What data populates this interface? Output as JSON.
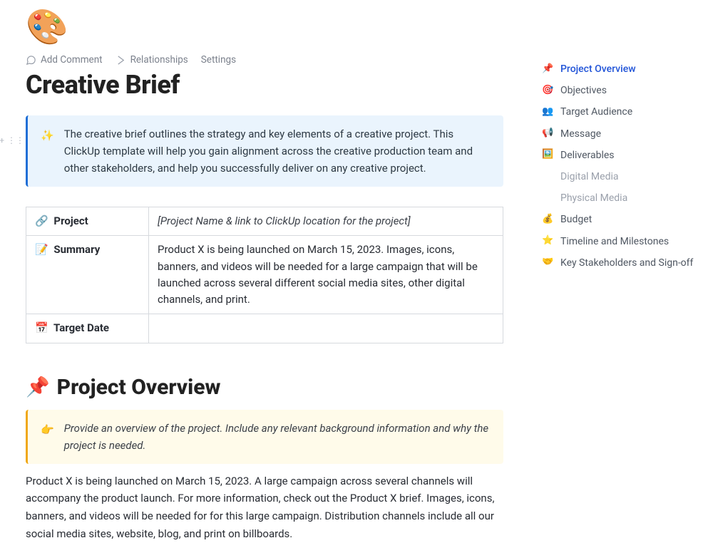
{
  "toolbar": {
    "add_comment": "Add Comment",
    "relationships": "Relationships",
    "settings": "Settings"
  },
  "page_title": "Creative Brief",
  "callout_intro": {
    "emoji": "✨",
    "text": "The creative brief outlines the strategy and key elements of a creative project. This ClickUp template will help you gain alignment across the creative production team and other stakeholders, and help you successfully deliver on any creative project."
  },
  "info_table": {
    "project": {
      "emoji": "🔗",
      "label": "Project",
      "value": "[Project Name & link to ClickUp location for the project]"
    },
    "summary": {
      "emoji": "📝",
      "label": "Summary",
      "value": "Product X is being launched on March 15, 2023. Images, icons, banners, and videos will be needed for a large campaign that will be launched across several different social media sites, other digital channels, and print."
    },
    "target_date": {
      "emoji": "📅",
      "label": "Target Date",
      "value": ""
    }
  },
  "section_overview": {
    "emoji": "📌",
    "title": "Project Overview",
    "hint_emoji": "👉",
    "hint": "Provide an overview of the project. Include any relevant background information and why the project is needed.",
    "body": "Product X is being launched on March 15, 2023. A large campaign across several channels will accompany the product launch. For more information, check out the Product X brief. Images, icons, banners, and videos will be needed for for this large campaign. Distribution channels include all our social media sites, website, blog, and print on billboards."
  },
  "toc": {
    "items": [
      {
        "emoji": "📌",
        "label": "Project Overview",
        "active": true
      },
      {
        "emoji": "🎯",
        "label": "Objectives"
      },
      {
        "emoji": "👥",
        "label": "Target Audience"
      },
      {
        "emoji": "📢",
        "label": "Message"
      },
      {
        "emoji": "🖼️",
        "label": "Deliverables"
      }
    ],
    "subs": [
      {
        "label": "Digital Media"
      },
      {
        "label": "Physical Media"
      }
    ],
    "items2": [
      {
        "emoji": "💰",
        "label": "Budget"
      },
      {
        "emoji": "⭐",
        "label": "Timeline and Milestones"
      },
      {
        "emoji": "🤝",
        "label": "Key Stakeholders and Sign-off"
      }
    ]
  }
}
